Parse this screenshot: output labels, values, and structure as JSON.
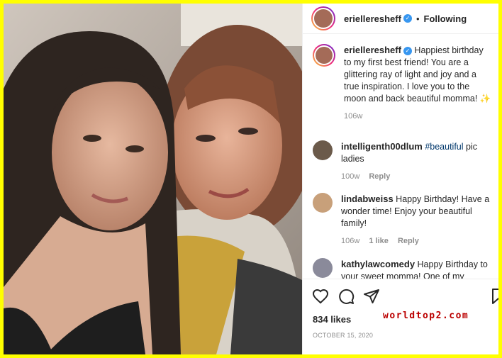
{
  "post": {
    "username": "erielleresheff",
    "follow_state": "Following",
    "caption": "Happiest birthday to my first best friend! You are a glittering ray of light and joy and a true inspiration. I love you to the moon and back beautiful momma! ✨",
    "caption_time": "106w",
    "likes": "834 likes",
    "date": "OCTOBER 15, 2020",
    "photo_icon": "selfie-photo"
  },
  "comments": [
    {
      "username": "intelligenth00dlum",
      "hashtag": "#beautiful",
      "text": " pic ladies",
      "time": "100w",
      "reply": "Reply"
    },
    {
      "username": "lindabweiss",
      "text": " Happy Birthday! Have a wonder time! Enjoy your beautiful family!",
      "time": "106w",
      "likes": "1 like",
      "reply": "Reply"
    },
    {
      "username": "kathylawcomedy",
      "text": " Happy Birthday to your sweet momma! One of my"
    }
  ],
  "icons": {
    "like": "heart-icon",
    "comment": "comment-icon",
    "share": "paper-plane-icon",
    "save": "bookmark-icon"
  },
  "watermark": "worldtop2.com",
  "colors": {
    "border": "#ffff00",
    "verified": "#3897f0",
    "hashtag": "#00376b",
    "watermark": "#bb0000"
  }
}
